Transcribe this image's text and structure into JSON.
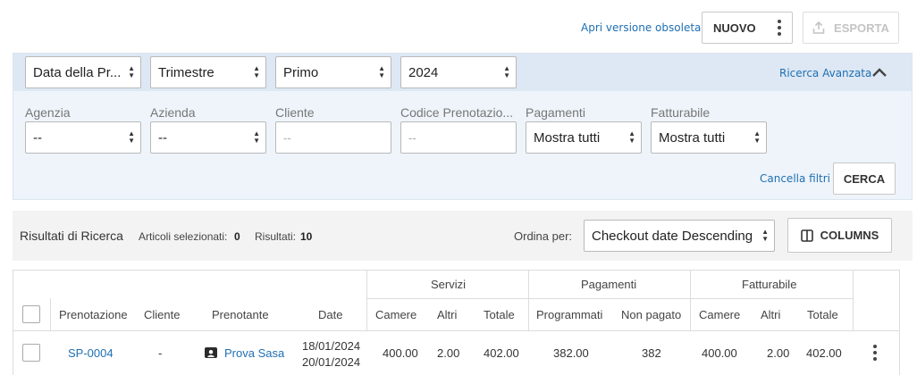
{
  "header": {
    "obsolete_link": "Apri versione obsoleta",
    "new_button": "NUOVO",
    "export_button": "ESPORTA"
  },
  "filters": {
    "date_type": "Data della Pr...",
    "period_type": "Trimestre",
    "period": "Primo",
    "year": "2024",
    "advanced_link": "Ricerca Avanzata",
    "agency": {
      "label": "Agenzia",
      "value": "--"
    },
    "company": {
      "label": "Azienda",
      "value": "--"
    },
    "client": {
      "label": "Cliente",
      "placeholder": "--"
    },
    "booking_code": {
      "label": "Codice Prenotazio...",
      "placeholder": "--"
    },
    "payments": {
      "label": "Pagamenti",
      "value": "Mostra tutti"
    },
    "billable": {
      "label": "Fatturabile",
      "value": "Mostra tutti"
    },
    "clear_link": "Cancella filtri",
    "search_button": "CERCA"
  },
  "results": {
    "title": "Risultati di Ricerca",
    "selected_label": "Articoli selezionati:",
    "selected_count": "0",
    "results_label": "Risultati:",
    "results_count": "10",
    "sort_label": "Ordina per:",
    "sort_value": "Checkout date Descending",
    "columns_button": "COLUMNS"
  },
  "table": {
    "groups": {
      "services": "Servizi",
      "payments": "Pagamenti",
      "billable": "Fatturabile"
    },
    "columns": {
      "booking": "Prenotazione",
      "client": "Cliente",
      "booker": "Prenotante",
      "date": "Date",
      "srv_rooms": "Camere",
      "srv_other": "Altri",
      "srv_total": "Totale",
      "pay_scheduled": "Programmati",
      "pay_unpaid": "Non pagato",
      "bill_rooms": "Camere",
      "bill_other": "Altri",
      "bill_total": "Totale"
    },
    "rows": [
      {
        "booking": "SP-0004",
        "client": "-",
        "booker": "Prova Sasa",
        "date_from": "18/01/2024",
        "date_to": "20/01/2024",
        "srv_rooms": "400.00",
        "srv_other": "2.00",
        "srv_total": "402.00",
        "pay_scheduled": "382.00",
        "pay_unpaid": "382",
        "bill_rooms": "400.00",
        "bill_other": "2.00",
        "bill_total": "402.00"
      }
    ]
  },
  "icons": {
    "more": "kebab-vertical-icon",
    "export": "upload-icon",
    "collapse": "chevron-up-icon",
    "columns": "columns-icon",
    "booker": "user-badge-icon"
  },
  "colors": {
    "link": "#1f6fb2",
    "panel_bg": "#eef4fa",
    "panel_head": "#dde8f4"
  }
}
